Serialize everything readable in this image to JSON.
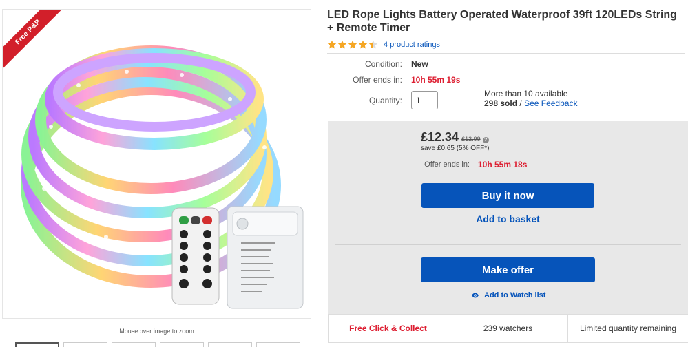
{
  "product": {
    "title": "LED Rope Lights Battery Operated Waterproof 39ft 120LEDs String + Remote Timer",
    "rating_stars": 4.5,
    "rating_link": "4 product ratings"
  },
  "image": {
    "ribbon": "Free P&P",
    "zoom_hint": "Mouse over image to zoom",
    "thumbnail_count": 6
  },
  "details": {
    "condition_label": "Condition:",
    "condition_value": "New",
    "offer_label": "Offer ends in:",
    "offer_value": "10h 55m 19s",
    "quantity_label": "Quantity:",
    "quantity_value": "1",
    "availability": "More than 10 available",
    "sold": "298 sold",
    "sold_separator": "/",
    "feedback_link": "See Feedback"
  },
  "buybox": {
    "price": "£12.34",
    "was_price": "£12.99",
    "info_icon": "info-icon",
    "save_text": "save £0.65 (5% OFF*)",
    "offer_label": "Offer ends in:",
    "offer_value": "10h 55m 18s",
    "buy_now": "Buy it now",
    "add_basket": "Add to basket",
    "make_offer": "Make offer",
    "watch_list": "Add to Watch list"
  },
  "strip": {
    "collect": "Free Click & Collect",
    "watchers": "239 watchers",
    "limited": "Limited quantity remaining"
  },
  "colors": {
    "brand_blue": "#0654ba",
    "alert_red": "#dd1e31",
    "ribbon_red": "#d21f2a",
    "star_orange": "#f5a623",
    "box_gray": "#e8e8e8"
  }
}
